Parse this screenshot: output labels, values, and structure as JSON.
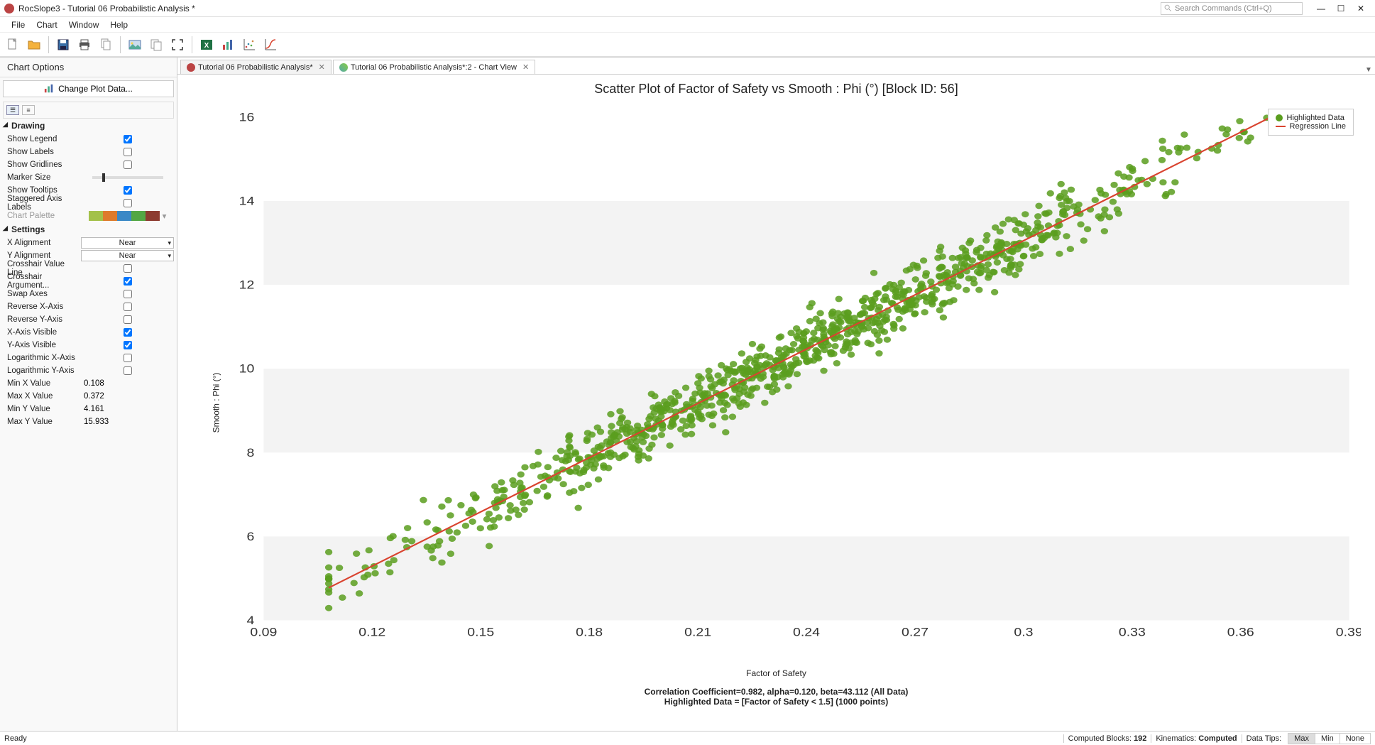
{
  "window": {
    "title": "RocSlope3 - Tutorial 06 Probabilistic Analysis *",
    "search_placeholder": "Search Commands (Ctrl+Q)"
  },
  "menu": {
    "items": [
      "File",
      "Chart",
      "Window",
      "Help"
    ]
  },
  "side": {
    "title": "Chart Options",
    "change_btn": "Change Plot Data...",
    "drawing_hdr": "Drawing",
    "settings_hdr": "Settings",
    "rows": {
      "show_legend": {
        "label": "Show Legend",
        "checked": true
      },
      "show_labels": {
        "label": "Show Labels",
        "checked": false
      },
      "show_gridlines": {
        "label": "Show Gridlines",
        "checked": false
      },
      "marker_size": {
        "label": "Marker Size"
      },
      "show_tooltips": {
        "label": "Show Tooltips",
        "checked": true
      },
      "staggered": {
        "label": "Staggered Axis Labels",
        "checked": false
      },
      "chart_palette": {
        "label": "Chart Palette"
      },
      "x_align": {
        "label": "X Alignment",
        "value": "Near"
      },
      "y_align": {
        "label": "Y Alignment",
        "value": "Near"
      },
      "crosshair_val": {
        "label": "Crosshair Value Line",
        "checked": false
      },
      "crosshair_arg": {
        "label": "Crosshair Argument...",
        "checked": true
      },
      "swap_axes": {
        "label": "Swap Axes",
        "checked": false
      },
      "reverse_x": {
        "label": "Reverse X-Axis",
        "checked": false
      },
      "reverse_y": {
        "label": "Reverse Y-Axis",
        "checked": false
      },
      "x_visible": {
        "label": "X-Axis Visible",
        "checked": true
      },
      "y_visible": {
        "label": "Y-Axis Visible",
        "checked": true
      },
      "log_x": {
        "label": "Logarithmic X-Axis",
        "checked": false
      },
      "log_y": {
        "label": "Logarithmic Y-Axis",
        "checked": false
      },
      "min_x": {
        "label": "Min X Value",
        "value": "0.108"
      },
      "max_x": {
        "label": "Max X Value",
        "value": "0.372"
      },
      "min_y": {
        "label": "Min Y Value",
        "value": "4.161"
      },
      "max_y": {
        "label": "Max Y Value",
        "value": "15.933"
      }
    },
    "palette_colors": [
      "#a3c14a",
      "#de7b2c",
      "#3a88c6",
      "#53a744",
      "#8d3b30"
    ]
  },
  "tabs": {
    "t1": "Tutorial 06 Probabilistic Analysis*",
    "t2": "Tutorial 06 Probabilistic Analysis*:2 - Chart View"
  },
  "chart": {
    "title": "Scatter Plot of Factor of Safety vs Smooth : Phi (°) [Block ID: 56]",
    "xlabel": "Factor of Safety",
    "ylabel": "Smooth : Phi (°)",
    "legend1": "Highlighted Data",
    "legend2": "Regression Line",
    "caption1": "Correlation Coefficient=0.982, alpha=0.120, beta=43.112 (All Data)",
    "caption2": "Highlighted Data = [Factor of Safety < 1.5] (1000 points)"
  },
  "chart_data": {
    "type": "scatter",
    "title": "Scatter Plot of Factor of Safety vs Smooth : Phi (°) [Block ID: 56]",
    "xlabel": "Factor of Safety",
    "ylabel": "Smooth : Phi (°)",
    "xlim": [
      0.09,
      0.39
    ],
    "ylim": [
      4,
      16
    ],
    "xticks": [
      0.09,
      0.12,
      0.15,
      0.18,
      0.21,
      0.24,
      0.27,
      0.3,
      0.33,
      0.36,
      0.39
    ],
    "yticks": [
      4,
      6,
      8,
      10,
      12,
      14,
      16
    ],
    "regression": {
      "alpha": 0.12,
      "beta": 43.112,
      "correlation": 0.982
    },
    "highlight_condition": "Factor of Safety < 1.5",
    "n_points": 1000,
    "data_description": "Approximately 1000 scattered points tightly correlated (r=0.982) along line y = 0.120 + 43.112·x, for x in roughly [0.108, 0.372] and y in roughly [4.161, 15.933]; scatter band sigma ≈ 0.35 in y."
  },
  "status": {
    "ready": "Ready",
    "computed_blocks_lbl": "Computed Blocks:",
    "computed_blocks_val": "192",
    "kinematics_lbl": "Kinematics:",
    "kinematics_val": "Computed",
    "datatips_lbl": "Data Tips:",
    "max": "Max",
    "min": "Min",
    "none": "None"
  }
}
